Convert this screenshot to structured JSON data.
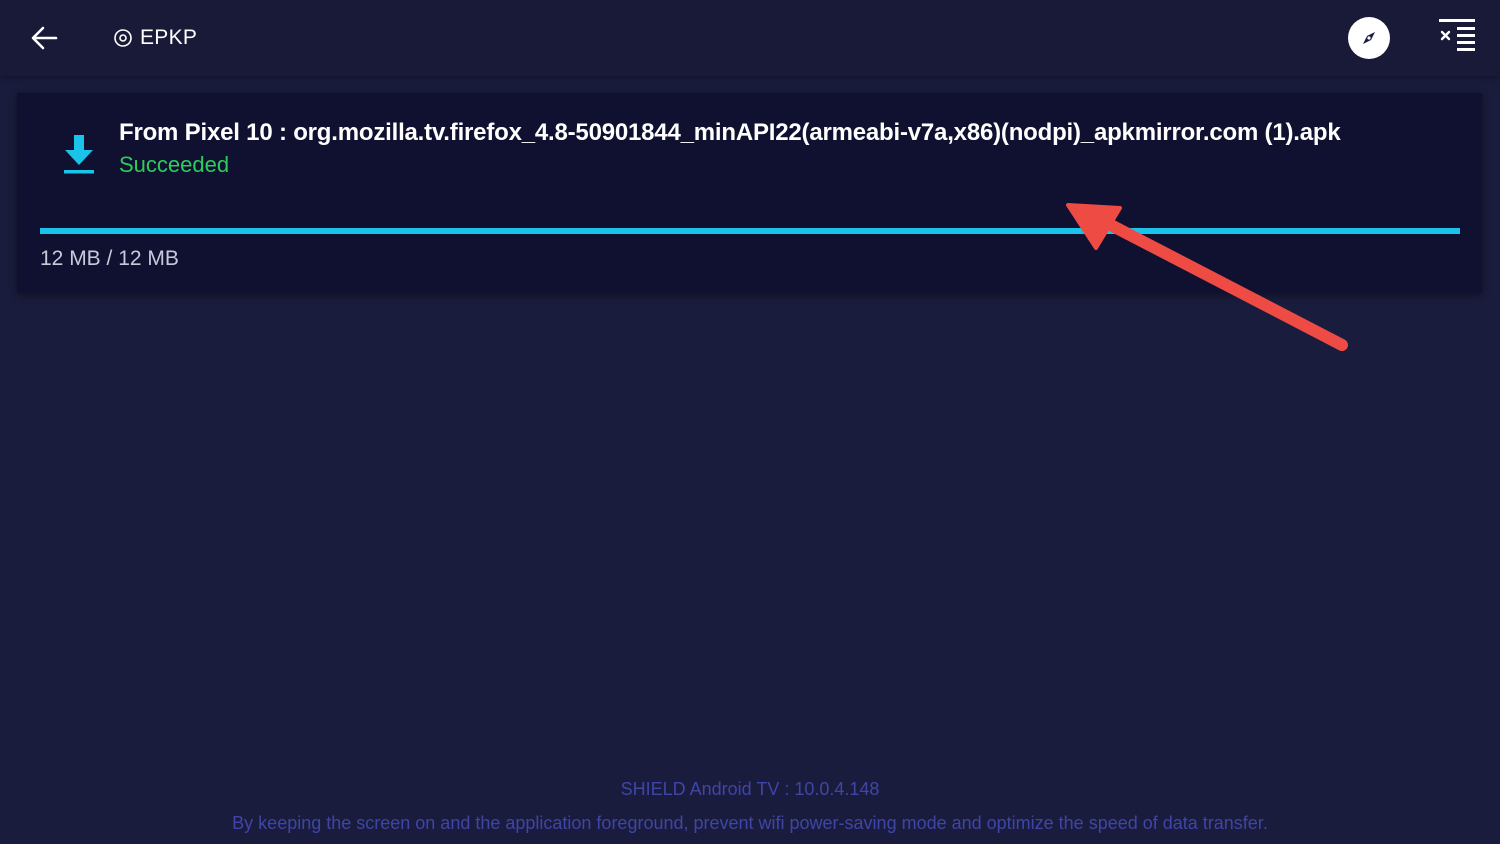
{
  "header": {
    "back_icon": "arrow-left-icon",
    "title": "EPKP",
    "title_icon": "target-circle-icon",
    "compass_icon": "compass-icon",
    "clear_icon": "clear-list-icon"
  },
  "transfer": {
    "icon": "download-icon",
    "file_name": "From Pixel 10 : org.mozilla.tv.firefox_4.8-50901844_minAPI22(armeabi-v7a,x86)(nodpi)_apkmirror.com (1).apk",
    "status": "Succeeded",
    "progress": 1.0,
    "size_text": "12 MB / 12 MB"
  },
  "footer": {
    "device": "SHIELD Android TV : 10.0.4.148",
    "tip": "By keeping the screen on and the application foreground, prevent wifi power-saving mode and optimize the speed of data transfer."
  },
  "colors": {
    "background": "#1a1c3d",
    "card": "#101130",
    "success": "#2ecc5a",
    "accent": "#19c3ea",
    "annotation": "#ee4b45",
    "footer_text": "#3f45a6"
  }
}
